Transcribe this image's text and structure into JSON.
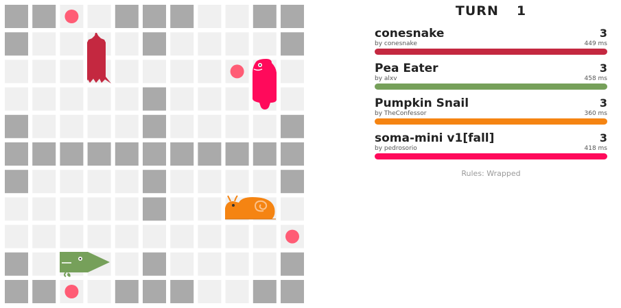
{
  "game": {
    "turn_label": "TURN",
    "turn": "1",
    "rules": "Rules: Wrapped",
    "board": {
      "width": 11,
      "height": 11,
      "hazards": [
        [
          0,
          0
        ],
        [
          1,
          0
        ],
        [
          4,
          0
        ],
        [
          5,
          0
        ],
        [
          6,
          0
        ],
        [
          9,
          0
        ],
        [
          10,
          0
        ],
        [
          0,
          1
        ],
        [
          5,
          1
        ],
        [
          10,
          1
        ],
        [
          5,
          3
        ],
        [
          0,
          4
        ],
        [
          5,
          4
        ],
        [
          10,
          4
        ],
        [
          0,
          5
        ],
        [
          1,
          5
        ],
        [
          2,
          5
        ],
        [
          3,
          5
        ],
        [
          4,
          5
        ],
        [
          5,
          5
        ],
        [
          6,
          5
        ],
        [
          7,
          5
        ],
        [
          8,
          5
        ],
        [
          9,
          5
        ],
        [
          10,
          5
        ],
        [
          0,
          6
        ],
        [
          5,
          6
        ],
        [
          10,
          6
        ],
        [
          5,
          7
        ],
        [
          0,
          9
        ],
        [
          5,
          9
        ],
        [
          10,
          9
        ],
        [
          0,
          10
        ],
        [
          1,
          10
        ],
        [
          4,
          10
        ],
        [
          5,
          10
        ],
        [
          6,
          10
        ],
        [
          9,
          10
        ],
        [
          10,
          10
        ]
      ],
      "food": [
        [
          2,
          0
        ],
        [
          8,
          2
        ],
        [
          10,
          8
        ],
        [
          2,
          10
        ]
      ]
    },
    "snakes": [
      {
        "name": "conesnake",
        "author": "by conesnake",
        "length": "3",
        "latency": "449 ms",
        "color": "#c42840",
        "icon": "cone-head-icon",
        "head": [
          3,
          2
        ],
        "body": [
          [
            3,
            1
          ],
          [
            3,
            2
          ]
        ]
      },
      {
        "name": "Pea Eater",
        "author": "by alxv",
        "length": "3",
        "latency": "458 ms",
        "color": "#76a05a",
        "icon": "pea-eater-head-icon",
        "head": [
          3,
          9
        ],
        "body": [
          [
            2,
            9
          ],
          [
            3,
            9
          ]
        ]
      },
      {
        "name": "Pumpkin Snail",
        "author": "by TheConfessor",
        "length": "3",
        "latency": "360 ms",
        "color": "#f58412",
        "icon": "snail-icon",
        "head": [
          8,
          7
        ],
        "body": [
          [
            8,
            7
          ],
          [
            9,
            7
          ]
        ]
      },
      {
        "name": "soma-mini v1[fall]",
        "author": "by pedrosorio",
        "length": "3",
        "latency": "418 ms",
        "color": "#ff0a5b",
        "icon": "bottle-snake-icon",
        "head": [
          9,
          2
        ],
        "body": [
          [
            9,
            2
          ],
          [
            9,
            3
          ]
        ]
      }
    ]
  },
  "colors": {
    "empty_cell": "#f0f0f0",
    "hazard_cell": "#aaaaaa",
    "food": "#ff5c75"
  }
}
